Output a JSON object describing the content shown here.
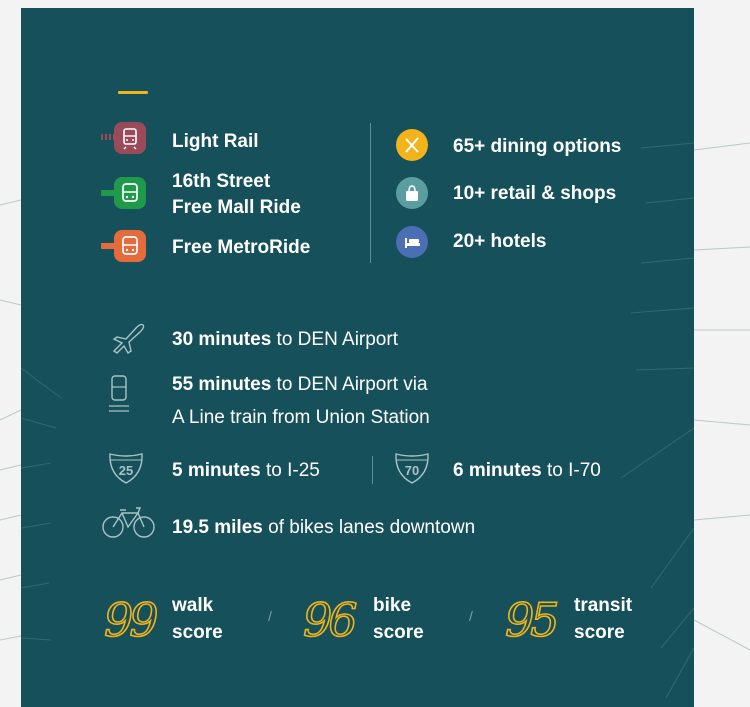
{
  "transit": [
    {
      "label": "Light Rail",
      "icon": "light-rail-icon",
      "color": "#9b4a5a"
    },
    {
      "label_line1": "16th Street",
      "label_line2": "Free Mall Ride",
      "icon": "bus-icon",
      "color": "#1f9a4a"
    },
    {
      "label": "Free MetroRide",
      "icon": "bus-icon",
      "color": "#e56a3c"
    }
  ],
  "amenities": [
    {
      "label": "65+ dining options",
      "icon": "fork-knife-icon",
      "color": "#f2b31b"
    },
    {
      "label": "10+  retail & shops",
      "icon": "shopping-bag-icon",
      "color": "#5a9ea0"
    },
    {
      "label": "20+ hotels",
      "icon": "bed-icon",
      "color": "#4a6fb5"
    }
  ],
  "travel": {
    "airport_drive": {
      "bold": "30 minutes",
      "rest": " to DEN Airport"
    },
    "airport_train": {
      "bold": "55 minutes",
      "rest": " to DEN Airport via",
      "line2": "A Line train from Union Station"
    },
    "i25": {
      "shield": "25",
      "bold": "5 minutes",
      "rest": " to I-25"
    },
    "i70": {
      "shield": "70",
      "bold": "6 minutes",
      "rest": " to I-70"
    },
    "bikes": {
      "bold": "19.5 miles",
      "rest": " of bikes lanes downtown"
    }
  },
  "scores": [
    {
      "value": "99",
      "line1": "walk",
      "line2": "score"
    },
    {
      "value": "96",
      "line1": "bike",
      "line2": "score"
    },
    {
      "value": "95",
      "line1": "transit",
      "line2": "score"
    }
  ],
  "colors": {
    "panel": "#16505a",
    "accent": "#f2b31b",
    "background": "#f3f3f3"
  }
}
